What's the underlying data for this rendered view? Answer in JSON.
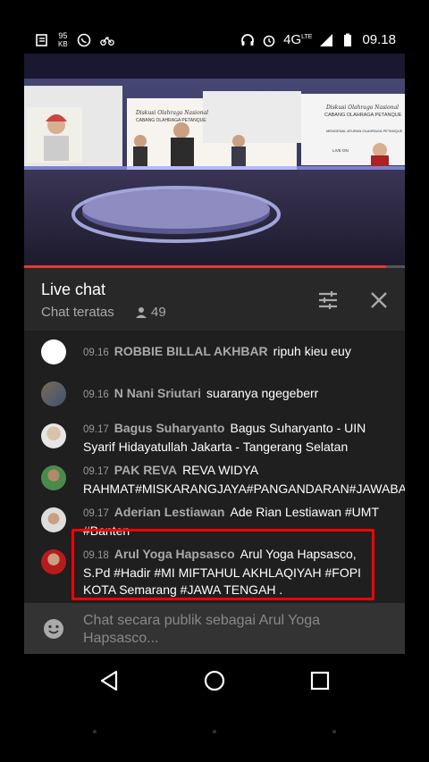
{
  "status_bar": {
    "kb_value": "95",
    "kb_unit": "KB",
    "network": "4G",
    "network_sup": "LTE",
    "time": "09.18"
  },
  "video": {
    "progress": 0.95,
    "slide_left_title": "Diskusi Olahraga Nasional",
    "slide_left_sub": "CABANG OLAHRAGA PETANQUE",
    "slide_right_title": "Diskusi Olahraga Nasional",
    "slide_right_sub": "CABANG OLAHRAGA PETANQUE",
    "slide_right_line": "MENGENAL ATURAN OLAHRAGA PETANQUE",
    "slide_right_live": "LIVE ON"
  },
  "header": {
    "title": "Live chat",
    "subtitle": "Chat teratas",
    "viewer_count": "49"
  },
  "messages": [
    {
      "time": "09.16",
      "author": "ROBBIE BILLAL AKHBAR",
      "text": "ripuh kieu euy"
    },
    {
      "time": "09.16",
      "author": "N Nani Sriutari",
      "text": "suaranya ngegeberr"
    },
    {
      "time": "09.17",
      "author": "Bagus Suharyanto",
      "text": "Bagus Suharyanto - UIN Syarif Hidayatullah Jakarta - Tangerang Selatan"
    },
    {
      "time": "09.17",
      "author": "PAK REVA",
      "text": "REVA WIDYA RAHMAT#MISKARANGJAYA#PANGANDARAN#JAWABARAT"
    },
    {
      "time": "09.17",
      "author": "Aderian Lestiawan",
      "text": "Ade Rian Lestiawan #UMT #Banten"
    },
    {
      "time": "09.18",
      "author": "Arul Yoga Hapsasco",
      "text": "Arul Yoga Hapsasco, S.Pd #Hadir #MI MIFTAHUL AKHLAQIYAH #FOPI KOTA Semarang #JAWA TENGAH ."
    }
  ],
  "input": {
    "placeholder": "Chat secara publik sebagai Arul Yoga Hapsasco..."
  },
  "colors": {
    "accent_red": "#ff0000",
    "progress_red": "#e53935",
    "panel_bg": "#1f1f1f",
    "header_bg": "#282828"
  },
  "icons": [
    "notes-icon",
    "whatsapp-icon",
    "bike-icon",
    "headset-icon",
    "alarm-icon",
    "signal-icon",
    "battery-icon",
    "filter-icon",
    "close-icon",
    "person-icon",
    "emoji-icon",
    "back-icon",
    "home-icon",
    "recents-icon"
  ]
}
